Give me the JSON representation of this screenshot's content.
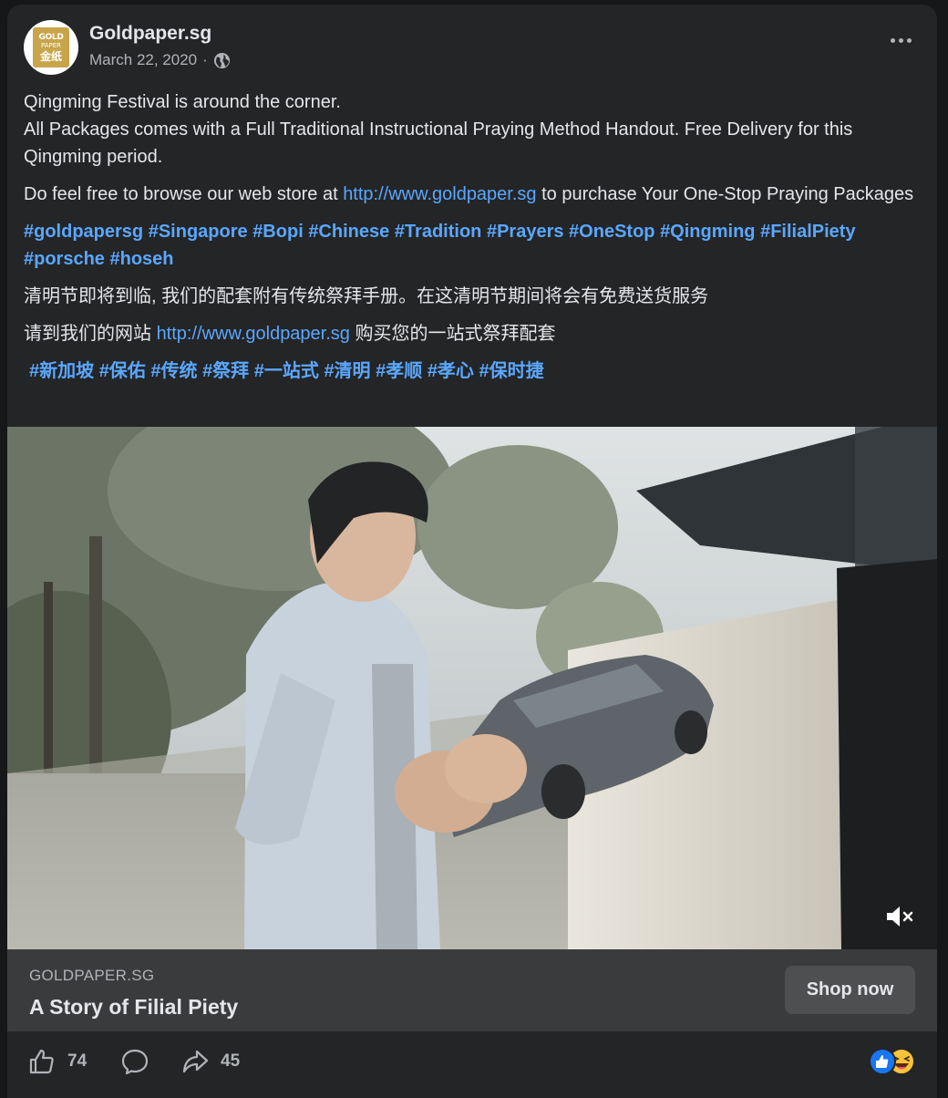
{
  "post": {
    "page_name": "Goldpaper.sg",
    "date": "March 22, 2020",
    "date_separator": "·",
    "avatar_logo": {
      "line1": "GOLD",
      "line2": "PAPER",
      "line3": "金纸"
    },
    "paragraph1_line1": "Qingming Festival is around the corner.",
    "paragraph1_line2": "All Packages comes with a Full Traditional Instructional Praying Method Handout. Free Delivery for this Qingming period.",
    "paragraph2_before": "Do feel free to browse our web store at ",
    "paragraph2_link": "http://www.goldpaper.sg",
    "paragraph2_after": " to purchase Your One-Stop Praying Packages",
    "hashtags_en": [
      "#goldpapersg",
      "#Singapore",
      "#Bopi",
      "#Chinese",
      "#Tradition",
      "#Prayers",
      "#OneStop",
      "#Qingming",
      "#FilialPiety",
      "#porsche",
      "#hoseh"
    ],
    "zh_paragraph1": "清明节即将到临, 我们的配套附有传统祭拜手册。在这清明节期间将会有免费送货服务",
    "zh_paragraph2_before": "请到我们的网站 ",
    "zh_paragraph2_link": "http://www.goldpaper.sg",
    "zh_paragraph2_after": " 购买您的一站式祭拜配套",
    "hashtags_zh": [
      "#新加坡",
      "#保佑",
      "#传统",
      "#祭拜",
      "#一站式",
      "#清明",
      "#孝顺",
      "#孝心",
      "#保时捷"
    ]
  },
  "cta": {
    "domain": "GOLDPAPER.SG",
    "title": "A Story of Filial Piety",
    "button_label": "Shop now"
  },
  "footer": {
    "like_count": "74",
    "share_count": "45"
  },
  "icons": {
    "more": "more-options-icon",
    "globe": "globe-icon",
    "mute": "speaker-muted-icon",
    "like": "thumbs-up-icon",
    "comment": "comment-icon",
    "share": "share-arrow-icon",
    "reactions": [
      "like-reaction-icon",
      "haha-reaction-icon"
    ]
  },
  "colors": {
    "card_bg": "#242526",
    "link": "#5aa7ff",
    "cta_bg": "#3a3b3c",
    "secondary_text": "#b0b3b8"
  }
}
